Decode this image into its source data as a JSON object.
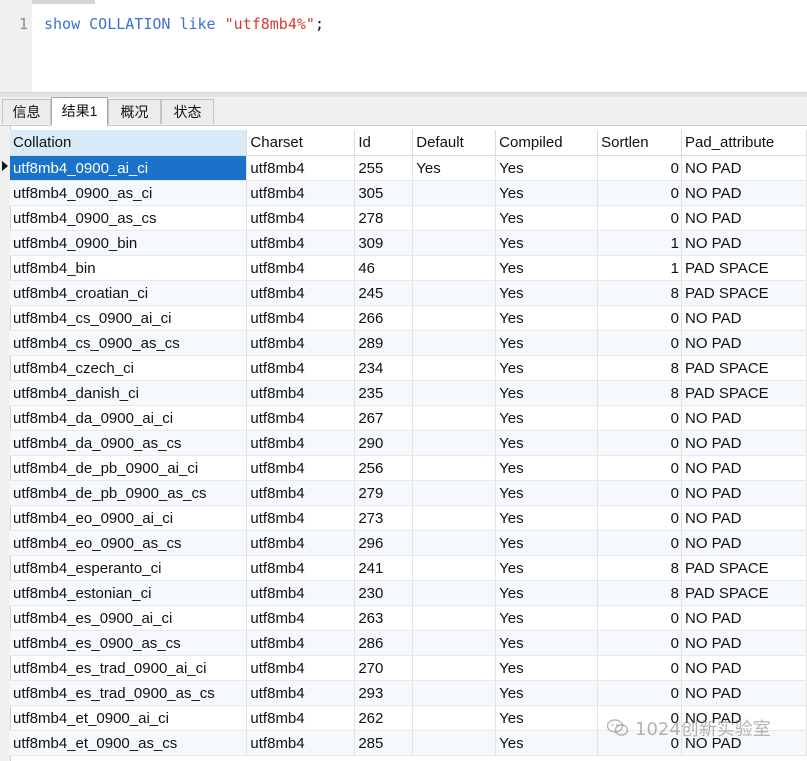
{
  "editor": {
    "line_number": "1",
    "tokens": {
      "kw1": "show",
      "kw2": "COLLATION",
      "kw3": "like",
      "str": "\"utf8mb4%\"",
      "end": ";"
    }
  },
  "tabs": [
    {
      "label": "信息",
      "active": false
    },
    {
      "label": "结果1",
      "active": true
    },
    {
      "label": "概况",
      "active": false
    },
    {
      "label": "状态",
      "active": false
    }
  ],
  "grid": {
    "columns": [
      "Collation",
      "Charset",
      "Id",
      "Default",
      "Compiled",
      "Sortlen",
      "Pad_attribute"
    ],
    "rows": [
      [
        "utf8mb4_0900_ai_ci",
        "utf8mb4",
        "255",
        "Yes",
        "Yes",
        "0",
        "NO PAD"
      ],
      [
        "utf8mb4_0900_as_ci",
        "utf8mb4",
        "305",
        "",
        "Yes",
        "0",
        "NO PAD"
      ],
      [
        "utf8mb4_0900_as_cs",
        "utf8mb4",
        "278",
        "",
        "Yes",
        "0",
        "NO PAD"
      ],
      [
        "utf8mb4_0900_bin",
        "utf8mb4",
        "309",
        "",
        "Yes",
        "1",
        "NO PAD"
      ],
      [
        "utf8mb4_bin",
        "utf8mb4",
        "46",
        "",
        "Yes",
        "1",
        "PAD SPACE"
      ],
      [
        "utf8mb4_croatian_ci",
        "utf8mb4",
        "245",
        "",
        "Yes",
        "8",
        "PAD SPACE"
      ],
      [
        "utf8mb4_cs_0900_ai_ci",
        "utf8mb4",
        "266",
        "",
        "Yes",
        "0",
        "NO PAD"
      ],
      [
        "utf8mb4_cs_0900_as_cs",
        "utf8mb4",
        "289",
        "",
        "Yes",
        "0",
        "NO PAD"
      ],
      [
        "utf8mb4_czech_ci",
        "utf8mb4",
        "234",
        "",
        "Yes",
        "8",
        "PAD SPACE"
      ],
      [
        "utf8mb4_danish_ci",
        "utf8mb4",
        "235",
        "",
        "Yes",
        "8",
        "PAD SPACE"
      ],
      [
        "utf8mb4_da_0900_ai_ci",
        "utf8mb4",
        "267",
        "",
        "Yes",
        "0",
        "NO PAD"
      ],
      [
        "utf8mb4_da_0900_as_cs",
        "utf8mb4",
        "290",
        "",
        "Yes",
        "0",
        "NO PAD"
      ],
      [
        "utf8mb4_de_pb_0900_ai_ci",
        "utf8mb4",
        "256",
        "",
        "Yes",
        "0",
        "NO PAD"
      ],
      [
        "utf8mb4_de_pb_0900_as_cs",
        "utf8mb4",
        "279",
        "",
        "Yes",
        "0",
        "NO PAD"
      ],
      [
        "utf8mb4_eo_0900_ai_ci",
        "utf8mb4",
        "273",
        "",
        "Yes",
        "0",
        "NO PAD"
      ],
      [
        "utf8mb4_eo_0900_as_cs",
        "utf8mb4",
        "296",
        "",
        "Yes",
        "0",
        "NO PAD"
      ],
      [
        "utf8mb4_esperanto_ci",
        "utf8mb4",
        "241",
        "",
        "Yes",
        "8",
        "PAD SPACE"
      ],
      [
        "utf8mb4_estonian_ci",
        "utf8mb4",
        "230",
        "",
        "Yes",
        "8",
        "PAD SPACE"
      ],
      [
        "utf8mb4_es_0900_ai_ci",
        "utf8mb4",
        "263",
        "",
        "Yes",
        "0",
        "NO PAD"
      ],
      [
        "utf8mb4_es_0900_as_cs",
        "utf8mb4",
        "286",
        "",
        "Yes",
        "0",
        "NO PAD"
      ],
      [
        "utf8mb4_es_trad_0900_ai_ci",
        "utf8mb4",
        "270",
        "",
        "Yes",
        "0",
        "NO PAD"
      ],
      [
        "utf8mb4_es_trad_0900_as_cs",
        "utf8mb4",
        "293",
        "",
        "Yes",
        "0",
        "NO PAD"
      ],
      [
        "utf8mb4_et_0900_ai_ci",
        "utf8mb4",
        "262",
        "",
        "Yes",
        "0",
        "NO PAD"
      ],
      [
        "utf8mb4_et_0900_as_cs",
        "utf8mb4",
        "285",
        "",
        "Yes",
        "0",
        "NO PAD"
      ]
    ],
    "selected_row": 0
  },
  "watermark": {
    "text": "1024创新实验室",
    "icon": "wechat-logo-icon"
  },
  "colors": {
    "selection": "#1a73c8",
    "sorted_header": "#d9ebf8",
    "keyword": "#3d6fd6",
    "string": "#d93a30"
  }
}
